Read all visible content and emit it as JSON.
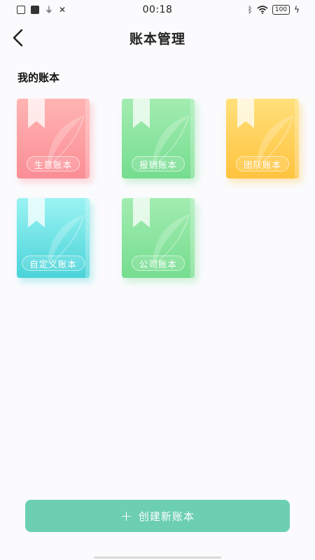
{
  "status_bar": {
    "time": "00:18",
    "battery": "100",
    "icons_left": [
      "sim-icon",
      "nfc-icon",
      "usb-icon",
      "tools-icon"
    ],
    "icons_right": [
      "bluetooth-icon",
      "wifi-icon",
      "battery-icon",
      "charging-icon"
    ]
  },
  "header": {
    "title": "账本管理",
    "back_icon": "chevron-left-icon"
  },
  "section": {
    "title": "我的账本"
  },
  "books": [
    {
      "label": "生意账本",
      "color": "#fb8d95"
    },
    {
      "label": "报销账本",
      "color": "#75dd8f"
    },
    {
      "label": "团队账本",
      "color": "#ffc33e"
    },
    {
      "label": "自定义账本",
      "color": "#49d3d8"
    },
    {
      "label": "公司账本",
      "color": "#75dd8f"
    }
  ],
  "footer": {
    "create_label": "创建新账本",
    "create_icon": "plus-icon",
    "button_color": "#6ccfb1"
  }
}
